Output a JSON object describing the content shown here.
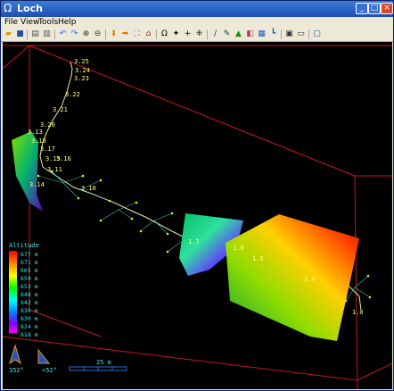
{
  "window": {
    "title": "Loch"
  },
  "menu": [
    "File",
    "View",
    "Tools",
    "Help"
  ],
  "toolbar_icons": [
    "open-icon",
    "save-icon",
    "print-icon",
    "print-preview-icon",
    "undo-icon",
    "redo-icon",
    "zoom-in-icon",
    "zoom-out-icon",
    "arrow-down-icon",
    "arrow-right-icon",
    "fit-icon",
    "home-icon",
    "omega-icon",
    "crosshair-icon",
    "plus-icon",
    "measure-icon",
    "pen-icon",
    "ruler-icon",
    "terrain-icon",
    "color-icon",
    "layers-icon",
    "chart-icon",
    "film-icon",
    "info-icon",
    "window-icon"
  ],
  "stations": [
    "3.25",
    "3.24",
    "3.23",
    "3.22",
    "3.21",
    "3.20",
    "3.19",
    "3.18",
    "3.17",
    "3.15",
    "3.16",
    "3.14",
    "3.11",
    "3.10",
    "3.13",
    "1.7",
    "1.6",
    "1.5",
    "1.4",
    "1.0"
  ],
  "legend": {
    "title": "Altitude",
    "values": [
      "677 m",
      "671 m",
      "665 m",
      "659 m",
      "653 m",
      "648 m",
      "642 m",
      "636 m",
      "630 m",
      "624 m",
      "618 m"
    ]
  },
  "compass": {
    "bearing": "352°",
    "tilt": "+52°"
  },
  "scale_bar": {
    "label": "25 m"
  }
}
